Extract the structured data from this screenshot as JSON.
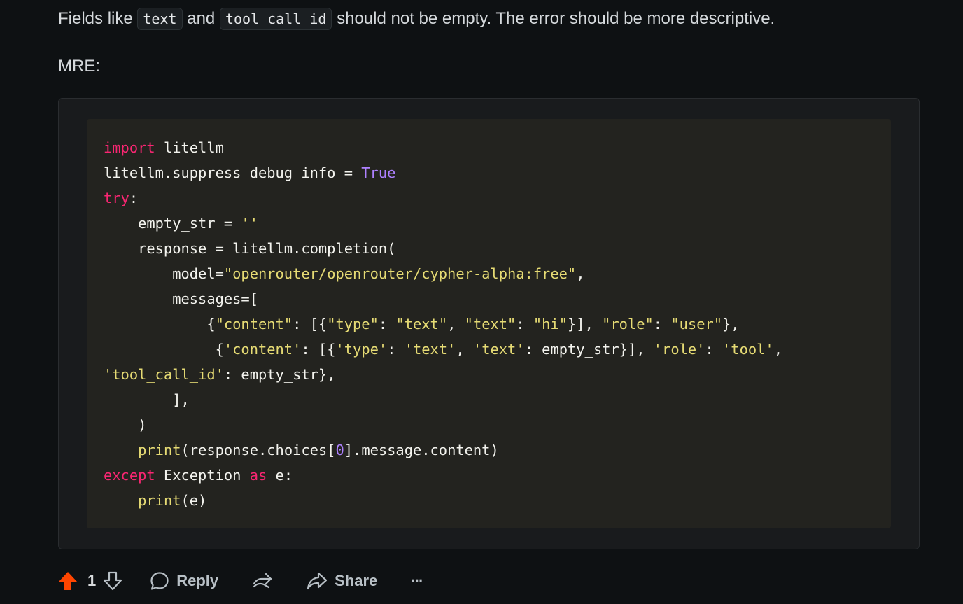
{
  "post": {
    "para1": {
      "before": "Fields like ",
      "code1": "text",
      "middle": " and ",
      "code2": "tool_call_id",
      "after": " should not be empty. The error should be more descriptive."
    },
    "para2": "MRE:"
  },
  "code": {
    "language": "python",
    "lines": [
      [
        {
          "t": "kw",
          "v": "import"
        },
        {
          "t": "pl",
          "v": " litellm"
        }
      ],
      [
        {
          "t": "pl",
          "v": "litellm.suppress_debug_info = "
        },
        {
          "t": "cn",
          "v": "True"
        }
      ],
      [
        {
          "t": "kw",
          "v": "try"
        },
        {
          "t": "pl",
          "v": ":"
        }
      ],
      [
        {
          "t": "pl",
          "v": "    empty_str = "
        },
        {
          "t": "st",
          "v": "''"
        }
      ],
      [
        {
          "t": "pl",
          "v": "    response = litellm.completion("
        }
      ],
      [
        {
          "t": "pl",
          "v": "        model="
        },
        {
          "t": "st",
          "v": "\"openrouter/openrouter/cypher-alpha:free\""
        },
        {
          "t": "pl",
          "v": ","
        }
      ],
      [
        {
          "t": "pl",
          "v": "        messages=["
        }
      ],
      [
        {
          "t": "pl",
          "v": "            {"
        },
        {
          "t": "st",
          "v": "\"content\""
        },
        {
          "t": "pl",
          "v": ": [{"
        },
        {
          "t": "st",
          "v": "\"type\""
        },
        {
          "t": "pl",
          "v": ": "
        },
        {
          "t": "st",
          "v": "\"text\""
        },
        {
          "t": "pl",
          "v": ", "
        },
        {
          "t": "st",
          "v": "\"text\""
        },
        {
          "t": "pl",
          "v": ": "
        },
        {
          "t": "st",
          "v": "\"hi\""
        },
        {
          "t": "pl",
          "v": "}], "
        },
        {
          "t": "st",
          "v": "\"role\""
        },
        {
          "t": "pl",
          "v": ": "
        },
        {
          "t": "st",
          "v": "\"user\""
        },
        {
          "t": "pl",
          "v": "},"
        }
      ],
      [
        {
          "t": "pl",
          "v": "             {"
        },
        {
          "t": "st",
          "v": "'content'"
        },
        {
          "t": "pl",
          "v": ": [{"
        },
        {
          "t": "st",
          "v": "'type'"
        },
        {
          "t": "pl",
          "v": ": "
        },
        {
          "t": "st",
          "v": "'text'"
        },
        {
          "t": "pl",
          "v": ", "
        },
        {
          "t": "st",
          "v": "'text'"
        },
        {
          "t": "pl",
          "v": ": empty_str}], "
        },
        {
          "t": "st",
          "v": "'role'"
        },
        {
          "t": "pl",
          "v": ": "
        },
        {
          "t": "st",
          "v": "'tool'"
        },
        {
          "t": "pl",
          "v": ","
        }
      ],
      [
        {
          "t": "st",
          "v": "'tool_call_id'"
        },
        {
          "t": "pl",
          "v": ": empty_str},"
        }
      ],
      [
        {
          "t": "pl",
          "v": "        ],"
        }
      ],
      [
        {
          "t": "pl",
          "v": "    )"
        }
      ],
      [
        {
          "t": "pl",
          "v": "    "
        },
        {
          "t": "fn",
          "v": "print"
        },
        {
          "t": "pl",
          "v": "(response.choices["
        },
        {
          "t": "cn",
          "v": "0"
        },
        {
          "t": "pl",
          "v": "].message.content)"
        }
      ],
      [
        {
          "t": "kw",
          "v": "except"
        },
        {
          "t": "pl",
          "v": " Exception "
        },
        {
          "t": "kw",
          "v": "as"
        },
        {
          "t": "pl",
          "v": " e:"
        }
      ],
      [
        {
          "t": "pl",
          "v": "    "
        },
        {
          "t": "fn",
          "v": "print"
        },
        {
          "t": "pl",
          "v": "(e)"
        }
      ]
    ]
  },
  "actions": {
    "upvote_icon": "arrow-up-icon",
    "vote_count": "1",
    "downvote_icon": "arrow-down-icon",
    "reply_icon": "speech-bubble-icon",
    "reply_label": "Reply",
    "award_icon": "crosspost-icon",
    "share_icon": "share-arrow-icon",
    "share_label": "Share",
    "more_icon": "ellipsis-icon",
    "more_label": "···"
  },
  "colors": {
    "page_bg": "#0e1113",
    "upvote_active": "#ff4500",
    "keyword": "#f92672",
    "constant": "#ae81ff",
    "string": "#e6db74"
  }
}
